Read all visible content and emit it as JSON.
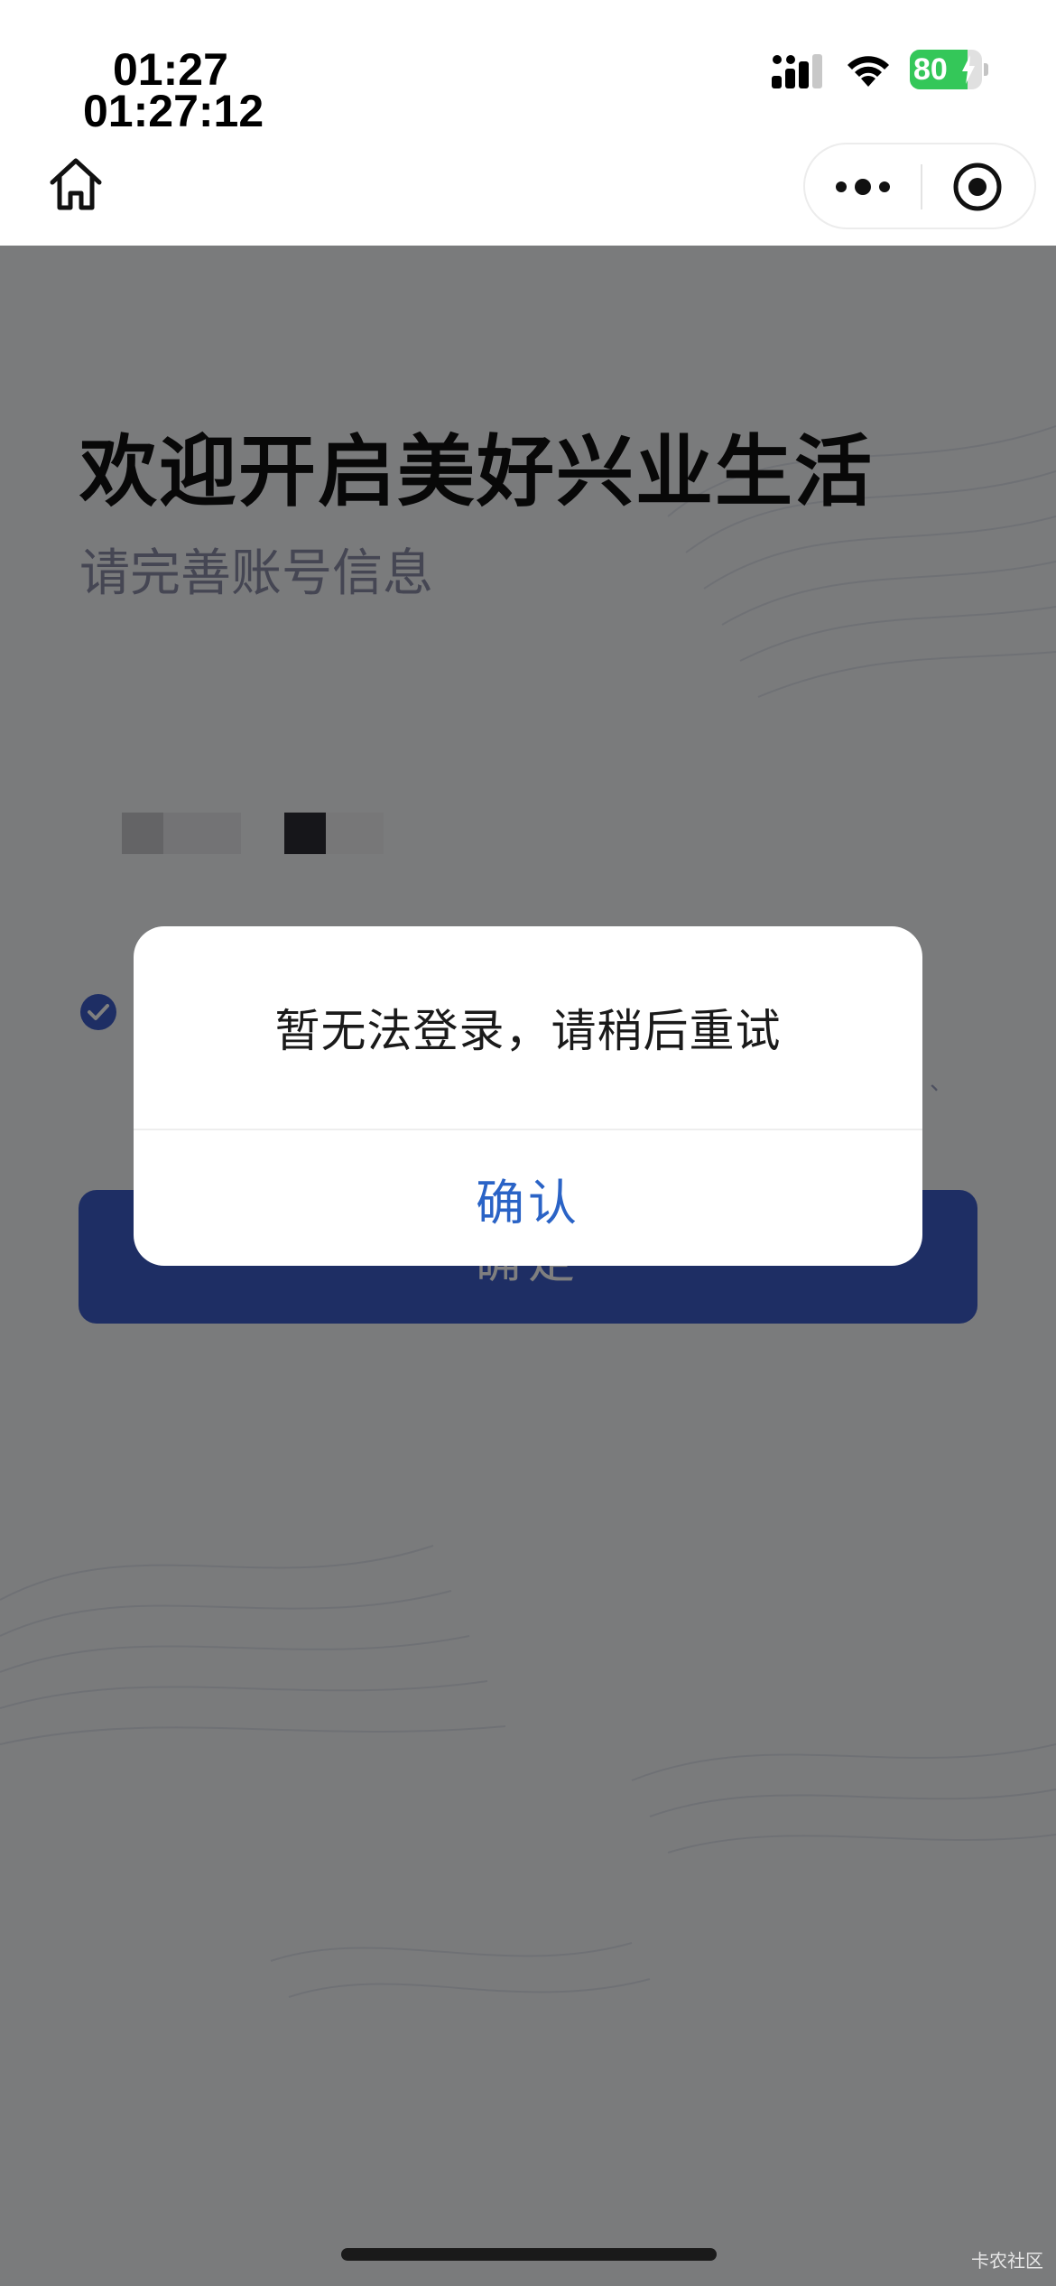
{
  "status_bar": {
    "time": "01:27",
    "time_seconds": "01:27:12",
    "battery_percent": "80",
    "battery_level": 0.8,
    "signal_icon": "cellular-signal-icon",
    "wifi_icon": "wifi-icon"
  },
  "nav": {
    "home_icon": "home-icon",
    "more_icon": "more-dots-icon",
    "close_icon": "target-close-icon"
  },
  "page": {
    "title": "欢迎开启美好兴业生活",
    "subtitle": "请完善账号信息",
    "agree_mark": "、",
    "confirm_button_label": "确定"
  },
  "dialog": {
    "message": "暂无法登录，请稍后重试",
    "confirm_label": "确认"
  },
  "watermark": "卡农社区",
  "colors": {
    "primary_button": "#3d5cc8",
    "dialog_confirm_text": "#2a63c6",
    "subtitle_text": "#8a8da6",
    "battery_green": "#34c759"
  }
}
